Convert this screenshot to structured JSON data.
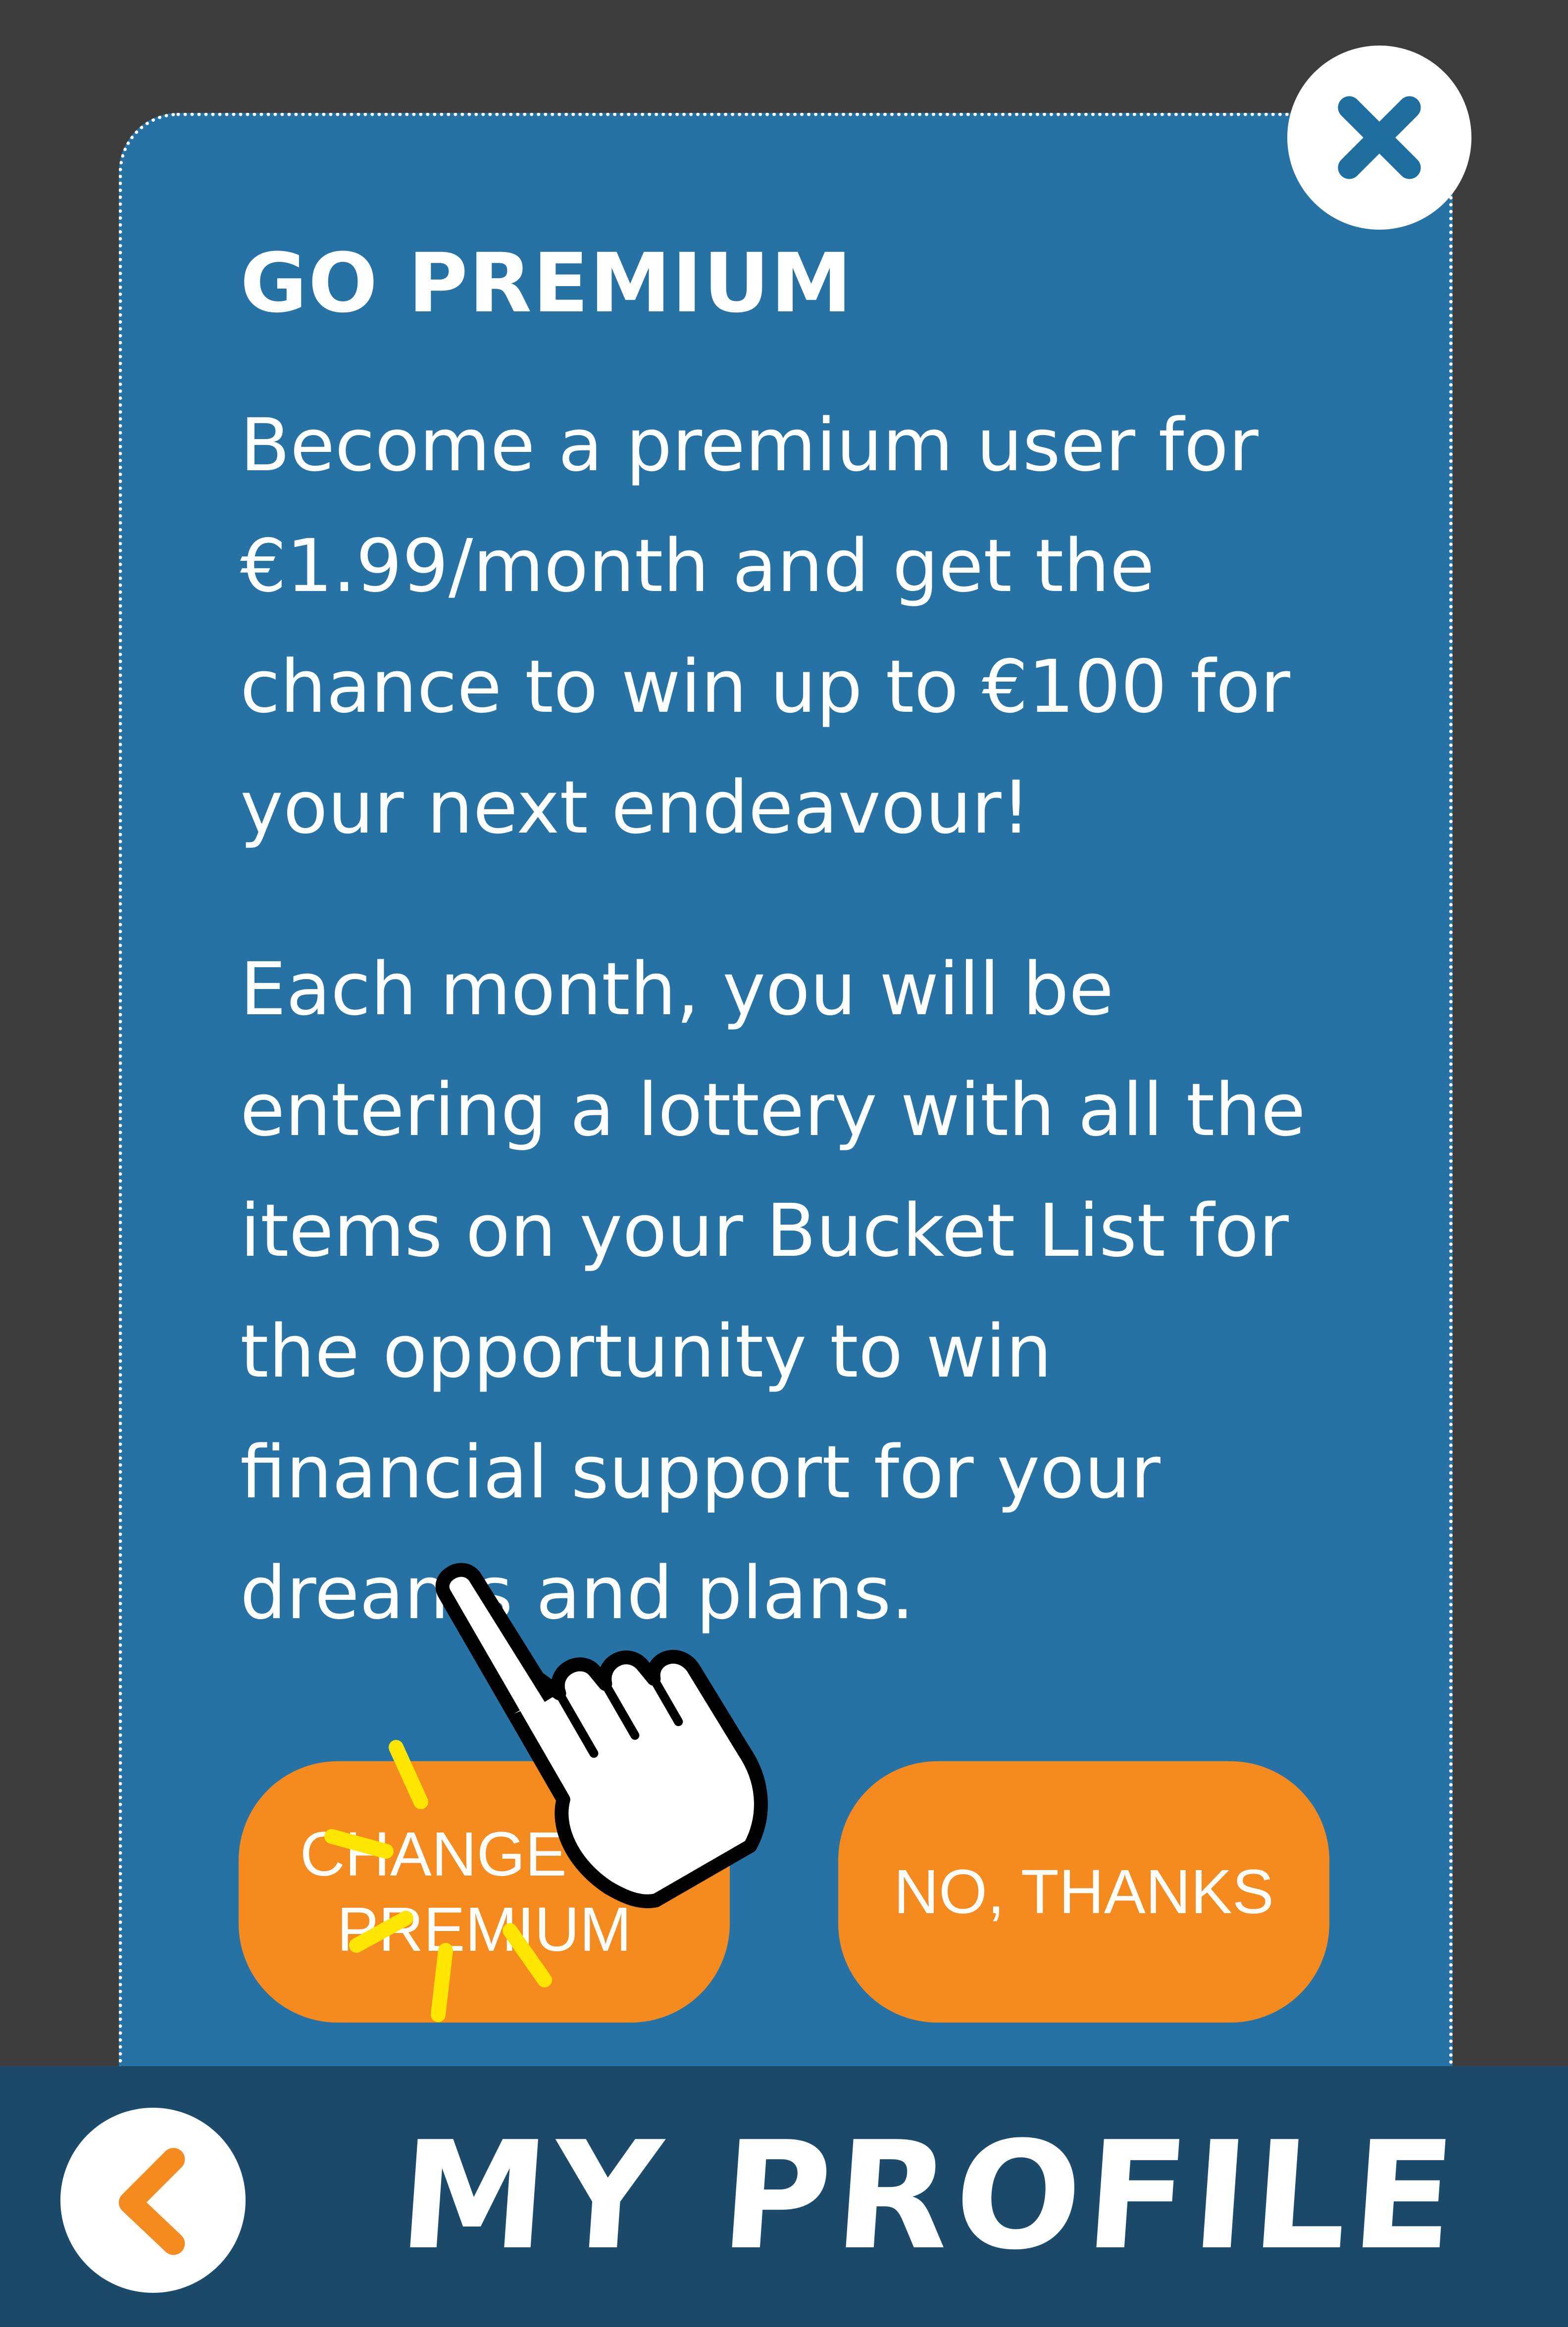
{
  "modal": {
    "title": "GO PREMIUM",
    "paragraph_1": "Become a premium user for €1.99/month and get the chance to win up to €100 for your next endeavour!",
    "paragraph_2": "Each month, you will be entering a lottery with all the items on your Bucket List for the opportunity to win financial support for your dreams and plans.",
    "buttons": {
      "premium_label": "CHANGE TO PREMIUM",
      "decline_label": "NO, THANKS"
    },
    "close_icon": "close-icon"
  },
  "bottom_bar": {
    "title": "MY PROFILE",
    "back_icon": "chevron-left-icon"
  },
  "overlay": {
    "cursor_icon": "pointing-hand-icon",
    "highlight_icon": "sparkle-icon"
  },
  "colors": {
    "background": "#3d3d3d",
    "modal": "#2772a5",
    "button": "#f58b1f",
    "bottom_bar": "#1b4a6b",
    "sparkle": "#ffe600"
  }
}
